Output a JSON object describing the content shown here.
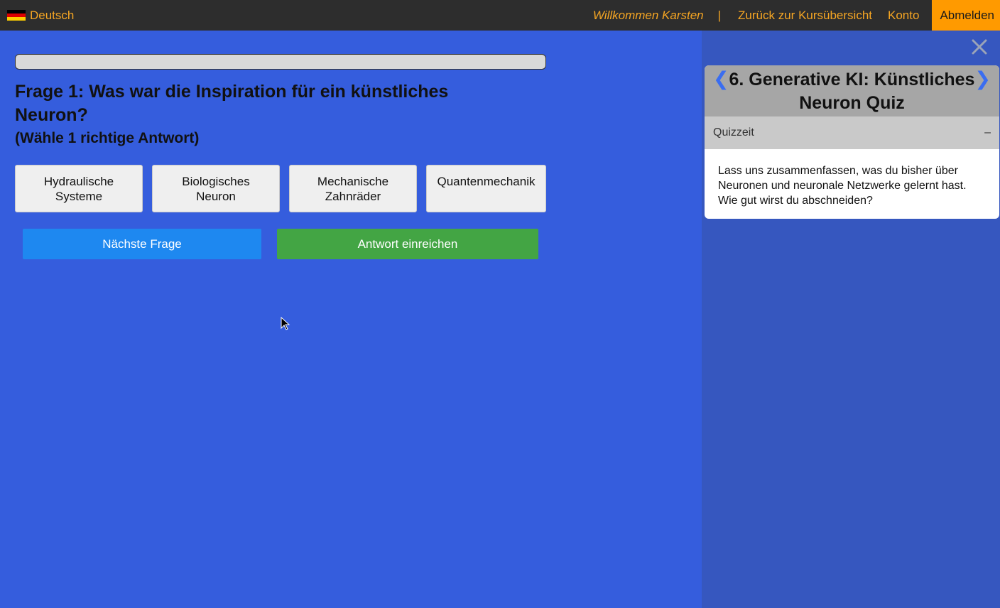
{
  "topbar": {
    "language": "Deutsch",
    "welcome": "Willkommen Karsten",
    "separator": "|",
    "back_link": "Zurück zur Kursübersicht",
    "account": "Konto",
    "logout": "Abmelden"
  },
  "quiz": {
    "progress_fraction": 0,
    "question": "Frage 1: Was war die Inspiration für ein künstliches Neuron?",
    "hint": "(Wähle 1 richtige Antwort)",
    "answers": [
      {
        "line1": "Hydraulische",
        "line2": "Systeme"
      },
      {
        "line1": "Biologisches",
        "line2": "Neuron"
      },
      {
        "line1": "Mechanische",
        "line2": "Zahnräder"
      },
      {
        "line1": "Quantenmechanik",
        "line2": ""
      }
    ],
    "next_label": "Nächste Frage",
    "submit_label": "Antwort einreichen"
  },
  "side": {
    "title": "6. Generative KI: Künstliches Neuron Quiz",
    "prev_symbol": "❮",
    "next_symbol": "❯",
    "section_title": "Quizzeit",
    "collapse_symbol": "–",
    "body": "Lass uns zusammenfassen, was du bisher über Neuronen und neuronale Netzwerke gelernt hast. Wie gut wirst du abschneiden?"
  },
  "colors": {
    "accent": "#f6a623",
    "logout_bg": "#ff9a00",
    "main_bg": "#355ddd",
    "next_button": "#1e88f0",
    "submit_button": "#43a544"
  }
}
